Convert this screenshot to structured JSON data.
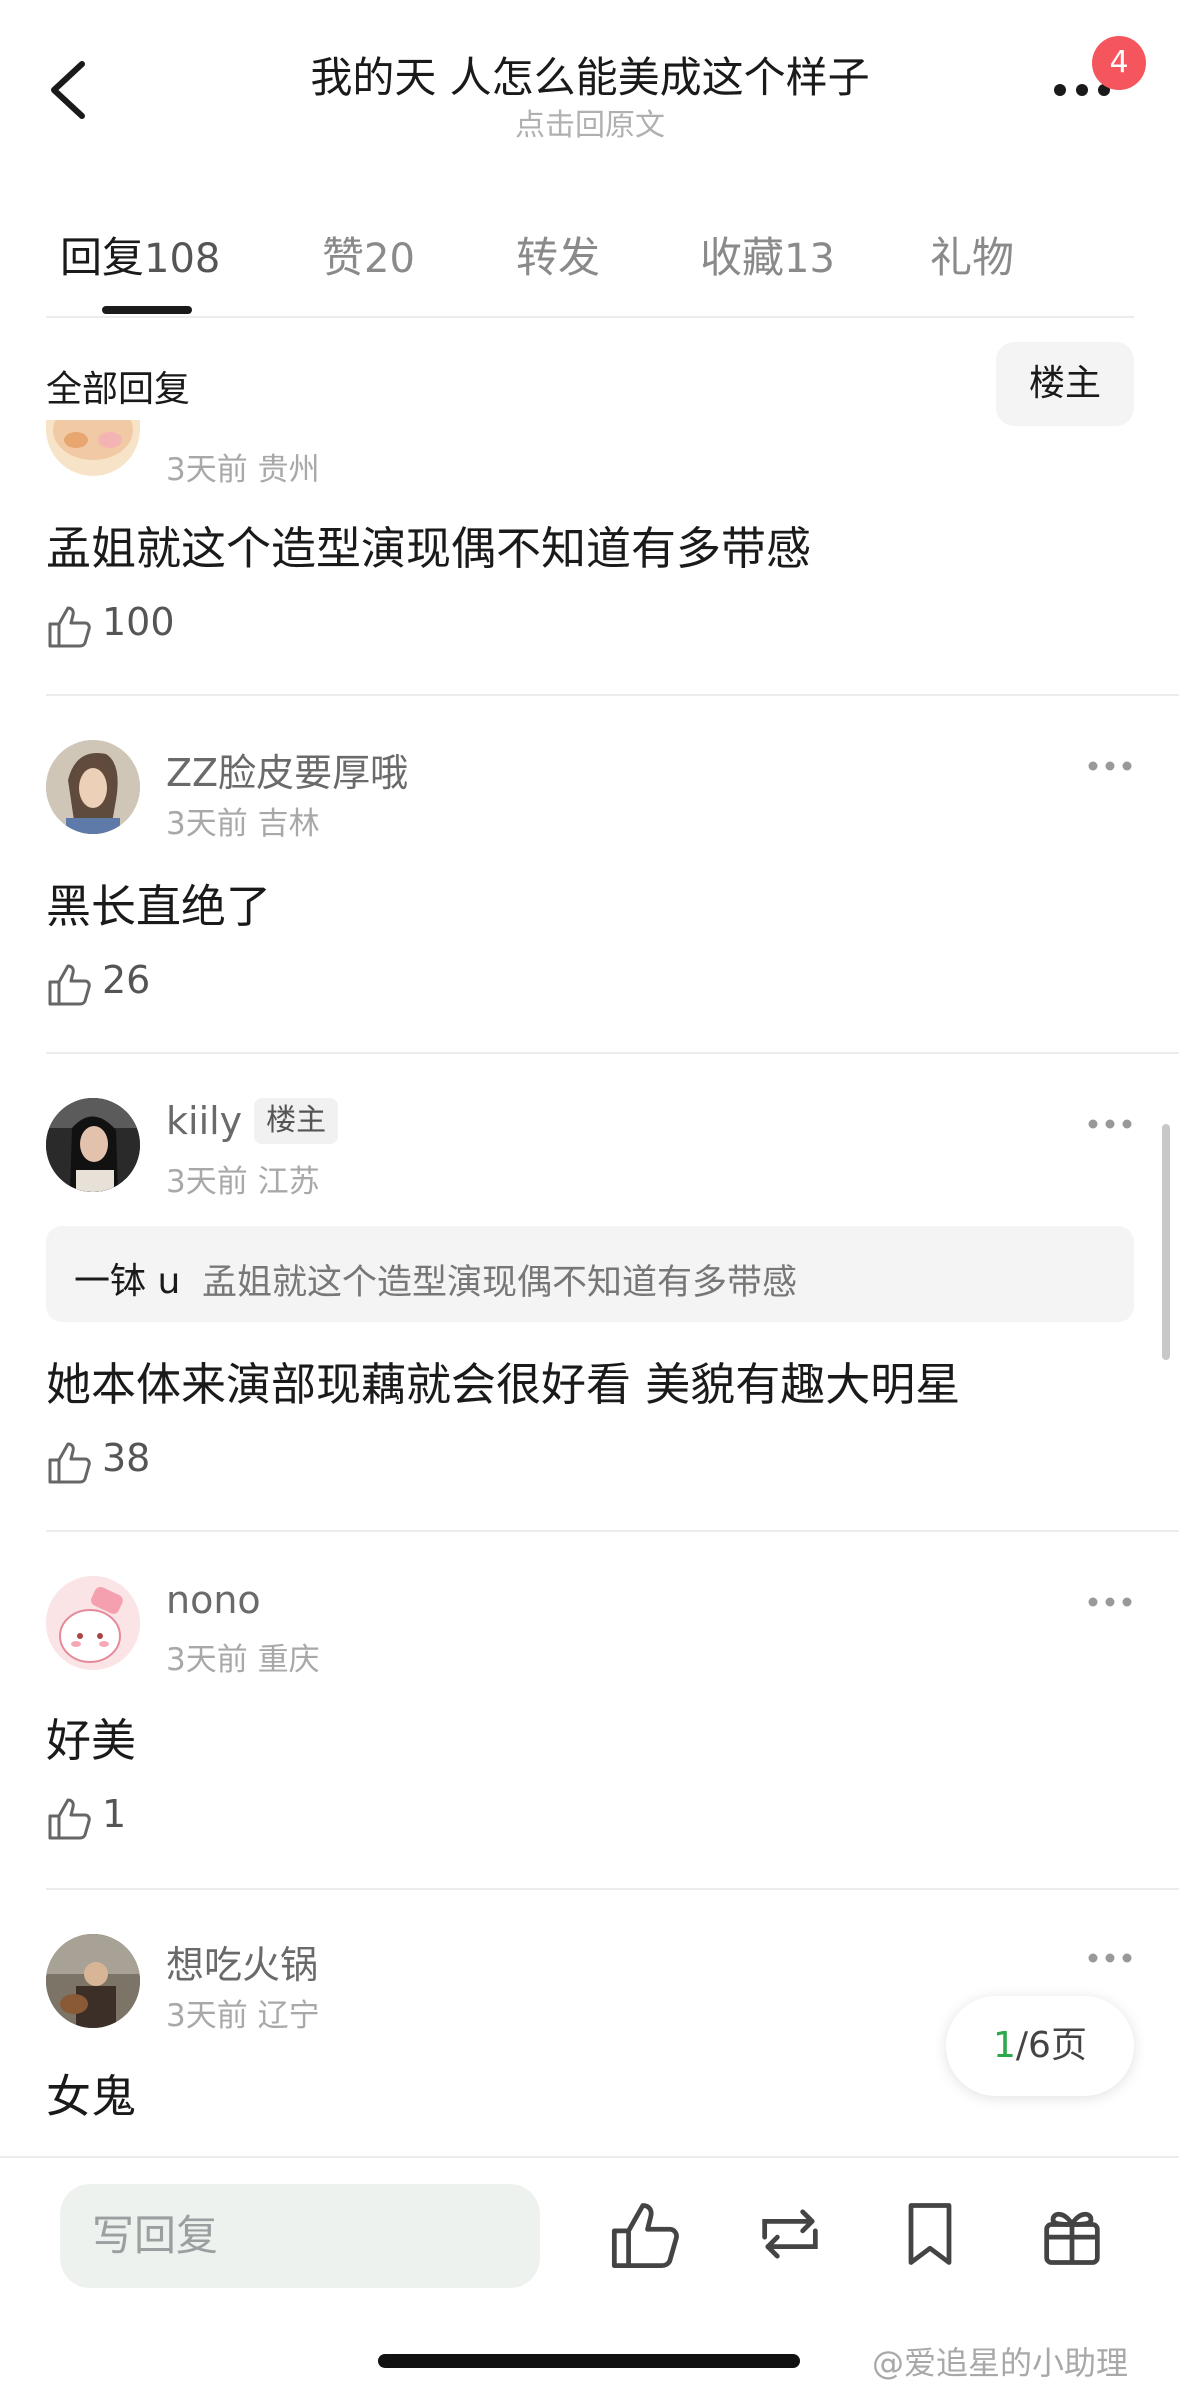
{
  "header": {
    "title": "我的天 人怎么能美成这个样子",
    "subtitle": "点击回原文",
    "notification_badge": "4"
  },
  "tabs": [
    {
      "label": "回复",
      "count": "108"
    },
    {
      "label": "赞",
      "count": "20"
    },
    {
      "label": "转发",
      "count": ""
    },
    {
      "label": "收藏",
      "count": "13"
    },
    {
      "label": "礼物",
      "count": ""
    }
  ],
  "filter": {
    "label": "全部回复",
    "op_button": "楼主"
  },
  "comments": [
    {
      "meta": "3天前 贵州",
      "text": "孟姐就这个造型演现偶不知道有多带感",
      "likes": "100"
    },
    {
      "username": "ZZ脸皮要厚哦",
      "meta": "3天前 吉林",
      "text": "黑长直绝了",
      "likes": "26"
    },
    {
      "username": "kiily",
      "tag": "楼主",
      "meta": "3天前 江苏",
      "quote_user": "一钵 u",
      "quote_text": "孟姐就这个造型演现偶不知道有多带感",
      "text": "她本体来演部现藕就会很好看 美貌有趣大明星",
      "likes": "38"
    },
    {
      "username": "nono",
      "meta": "3天前 重庆",
      "text": "好美",
      "likes": "1"
    },
    {
      "username": "想吃火锅",
      "meta": "3天前 辽宁",
      "text": "女鬼"
    }
  ],
  "pager": {
    "current": "1",
    "total_text": "/6页"
  },
  "bottom_bar": {
    "reply_placeholder": "写回复"
  },
  "watermark": "@爱追星的小助理",
  "colors": {
    "badge": "#f5555d",
    "pager_current": "#2ba84a",
    "input_bg": "#eef2ef"
  }
}
